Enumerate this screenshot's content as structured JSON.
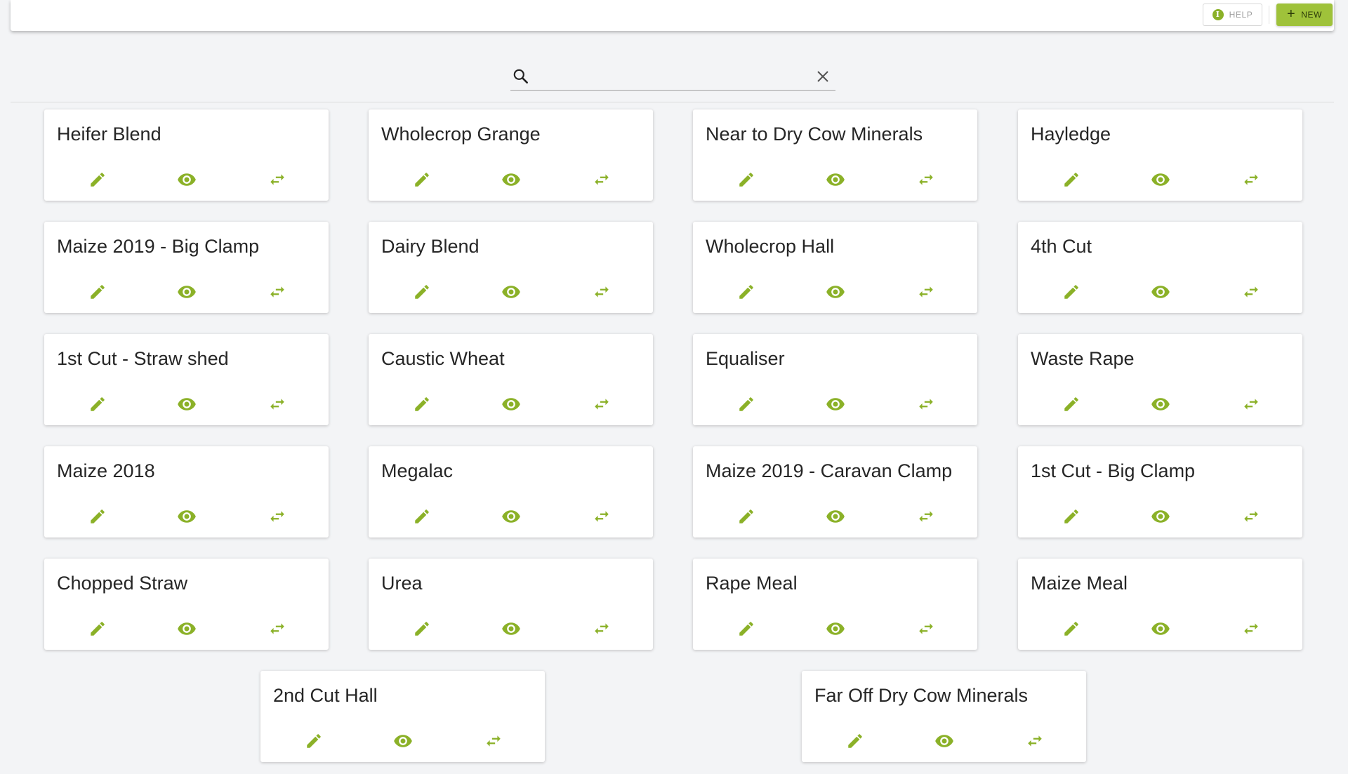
{
  "toolbar": {
    "help_label": "HELP",
    "new_label": "NEW"
  },
  "search": {
    "value": "",
    "placeholder": ""
  },
  "colors": {
    "accent": "#9fc23a",
    "icon": "#8bb128",
    "background": "#f3f4f6",
    "card": "#ffffff"
  },
  "icons": {
    "search": "search-icon",
    "clear": "close-icon",
    "edit": "pencil-icon",
    "view": "eye-icon",
    "swap": "swap-arrows-icon",
    "help": "info-icon",
    "new": "plus-icon"
  },
  "cards": [
    {
      "title": "Heifer Blend"
    },
    {
      "title": "Wholecrop Grange"
    },
    {
      "title": "Near to Dry Cow Minerals"
    },
    {
      "title": "Hayledge"
    },
    {
      "title": "Maize 2019 - Big Clamp"
    },
    {
      "title": "Dairy Blend"
    },
    {
      "title": "Wholecrop Hall"
    },
    {
      "title": "4th Cut"
    },
    {
      "title": "1st Cut - Straw shed"
    },
    {
      "title": "Caustic Wheat"
    },
    {
      "title": "Equaliser"
    },
    {
      "title": "Waste Rape"
    },
    {
      "title": "Maize 2018"
    },
    {
      "title": "Megalac"
    },
    {
      "title": "Maize 2019 - Caravan Clamp"
    },
    {
      "title": "1st Cut - Big Clamp"
    },
    {
      "title": "Chopped Straw"
    },
    {
      "title": "Urea"
    },
    {
      "title": "Rape Meal"
    },
    {
      "title": "Maize Meal"
    },
    {
      "title": "2nd Cut Hall"
    },
    {
      "title": "Far Off Dry Cow Minerals"
    }
  ]
}
